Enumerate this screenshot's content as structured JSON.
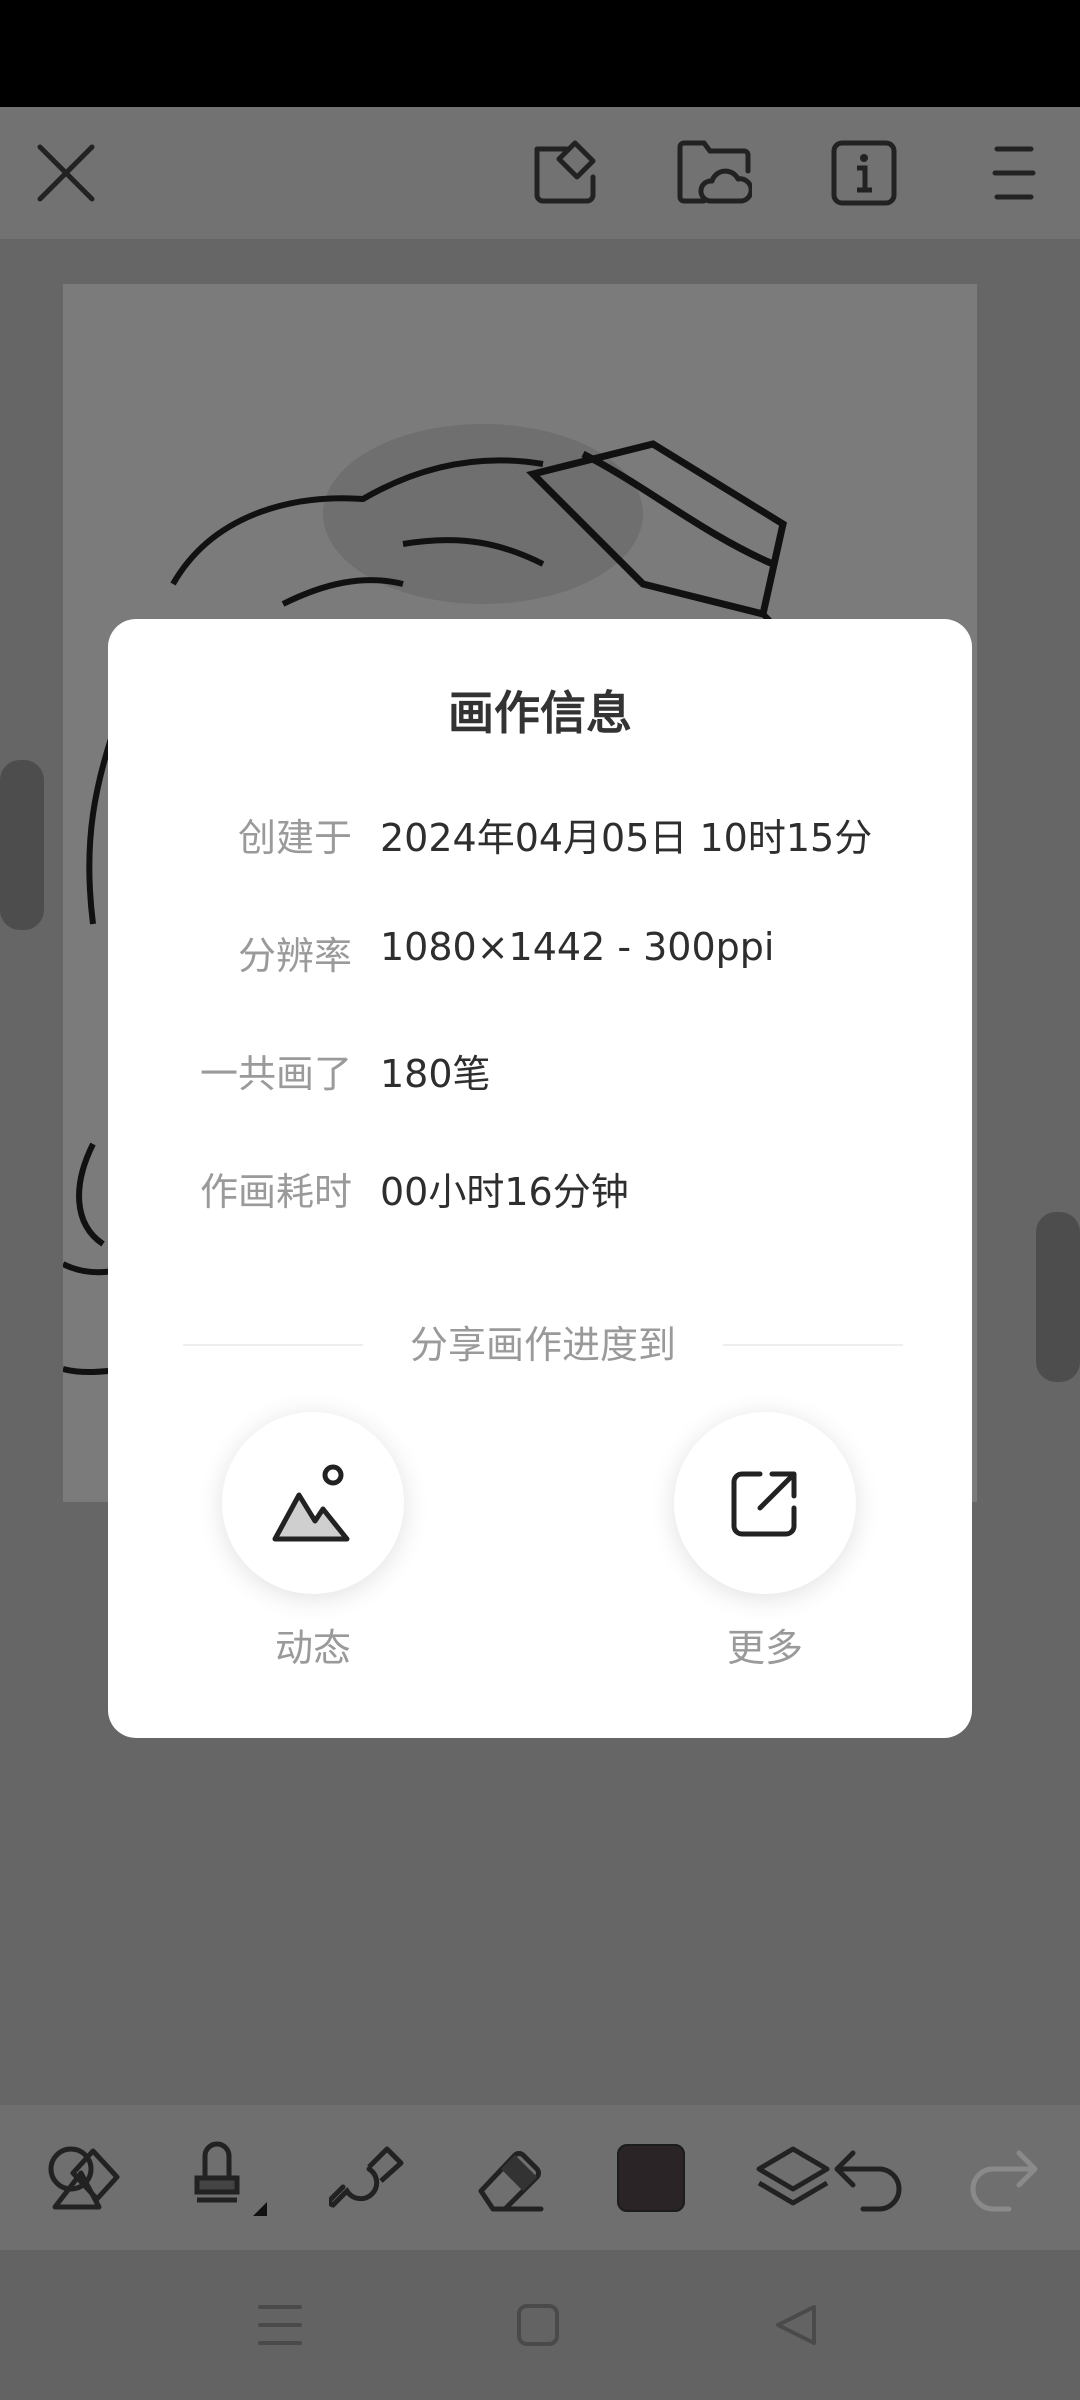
{
  "app_bar": {
    "close_icon": "close-icon",
    "actions": [
      "edit-shape-icon",
      "cloud-folder-icon",
      "info-icon",
      "menu-icon"
    ]
  },
  "dialog": {
    "title": "画作信息",
    "rows": [
      {
        "label": "创建于",
        "value": "2024年04月05日 10时15分"
      },
      {
        "label": "分辨率",
        "value": "1080×1442 - 300ppi"
      },
      {
        "label": "一共画了",
        "value": "180笔"
      },
      {
        "label": "作画耗时",
        "value": "00小时16分钟"
      }
    ],
    "share_title": "分享画作进度到",
    "share_options": [
      {
        "label": "动态",
        "icon": "mountain-image-icon"
      },
      {
        "label": "更多",
        "icon": "external-share-icon"
      }
    ]
  },
  "toolbar": {
    "tools": [
      "shapes-icon",
      "stamp-brush-icon",
      "smudge-icon",
      "eraser-icon",
      "color-swatch",
      "layers-icon",
      "undo-icon",
      "redo-icon"
    ],
    "current_color": "#2a2426"
  },
  "nav_bar": {
    "buttons": [
      "menu-nav-icon",
      "home-nav-icon",
      "back-nav-icon"
    ]
  }
}
